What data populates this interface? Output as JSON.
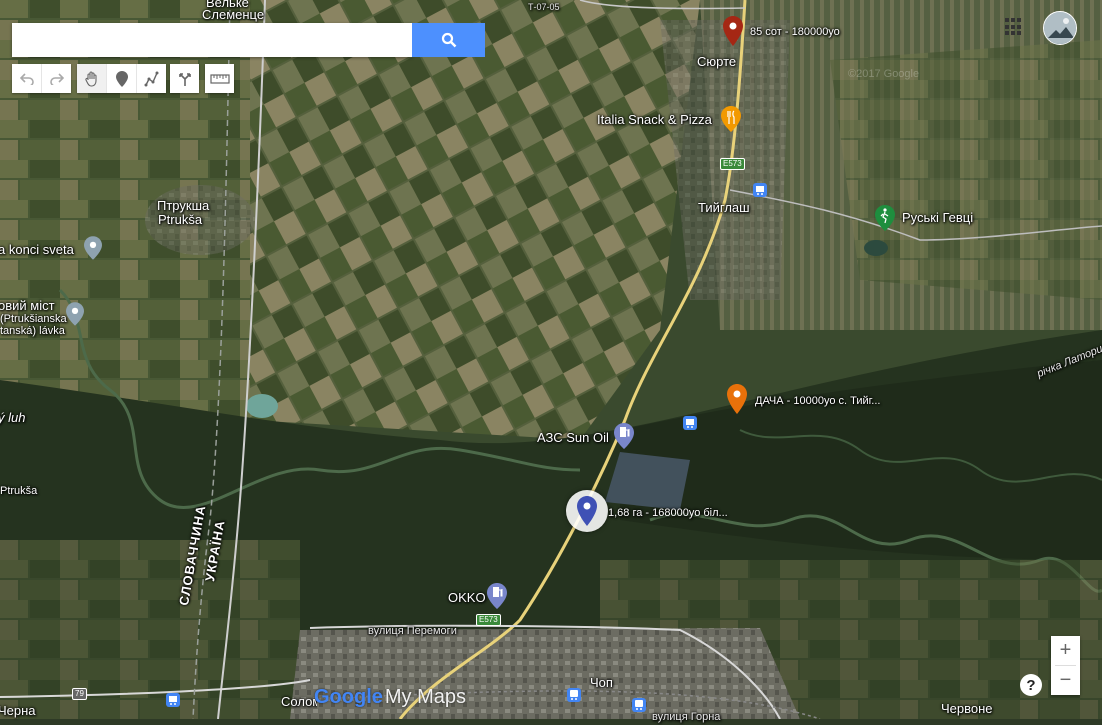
{
  "search": {
    "placeholder": "",
    "value": ""
  },
  "toolbar": {
    "undo_icon": "undo-icon",
    "redo_icon": "redo-icon",
    "pan_icon": "hand-icon",
    "marker_icon": "marker-icon",
    "draw_icon": "draw-line-icon",
    "directions_icon": "directions-icon",
    "measure_icon": "ruler-icon"
  },
  "markers": [
    {
      "label": "85 сот - 180000уо",
      "color": "#a52714"
    },
    {
      "label": "ДАЧА - 10000уо с. Тийг...",
      "color": "#e8710a"
    },
    {
      "label": "1,68 га - 168000уо біл...",
      "color": "#3f51b5"
    }
  ],
  "places": {
    "syurte": "Сюрте",
    "italia": "Italia Snack & Pizza",
    "tyiglash": "Тийглаш",
    "ruski_geivtsi": "Руськi Гевцi",
    "ptrukscha_uk": "Птрукша",
    "ptrukscha_sk": "Ptrukša",
    "koncisveta": "a konci sveta",
    "novyi_mist": "овий міст",
    "ptrukscha_lavka": "(Ptrukšianska",
    "ptrukscha_lavka2": "tanská) lávka",
    "azs": "АЗС Sun Oil",
    "okko": "OKKO",
    "chop": "Чоп",
    "chervone": "Червоне",
    "velke_slemence": "Вельке",
    "slemence": "Слеменце",
    "luh": "ý luh",
    "ptrukscha_sk2": "Ptrukša",
    "solomonovo": "Соломоново",
    "chorna": "Черна",
    "perem_street": "вулиця Перемоги",
    "gorna_street": "вулиця Горна",
    "latorytsia": "річка Латориця",
    "border_sk": "СЛОВАЧЧИНА",
    "border_ua": "УКРАЇНА"
  },
  "roads": {
    "e573": "E573",
    "e573b": "E573",
    "r79": "79",
    "top_road": "Т-07-05"
  },
  "branding": {
    "logo_google": "Google",
    "logo_mymaps": "My Maps",
    "copyright": "©2017 Google"
  },
  "controls": {
    "zoom_in": "+",
    "zoom_out": "−",
    "help": "?"
  }
}
